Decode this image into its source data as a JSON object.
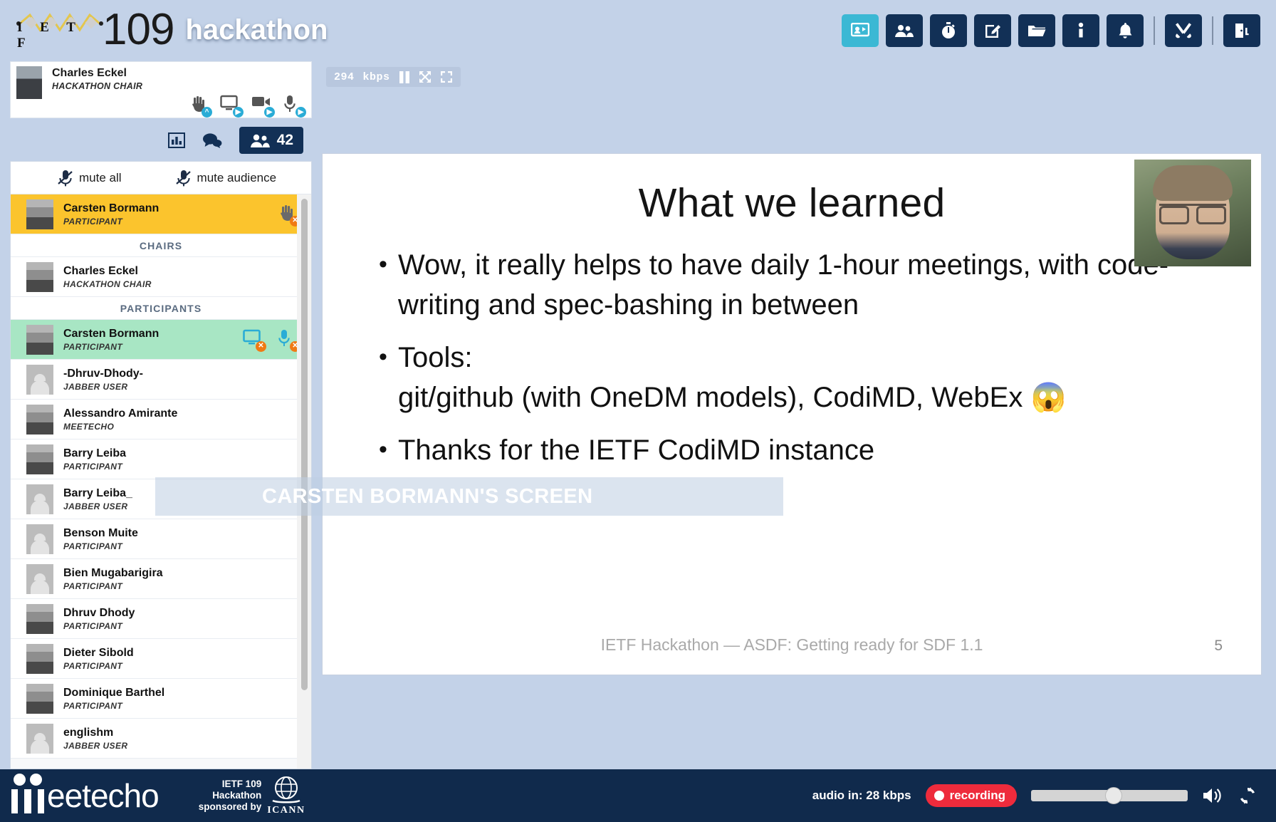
{
  "header": {
    "logo_letters": "I E T F",
    "number": "109",
    "event": "hackathon",
    "toolbar": [
      {
        "name": "share-screen-icon",
        "label": "Share screen",
        "active": true
      },
      {
        "name": "participants-icon",
        "label": "Participants",
        "active": false
      },
      {
        "name": "timer-icon",
        "label": "Timer",
        "active": false
      },
      {
        "name": "edit-icon",
        "label": "Notes",
        "active": false
      },
      {
        "name": "folder-icon",
        "label": "Materials",
        "active": false
      },
      {
        "name": "info-icon",
        "label": "Info",
        "active": false
      },
      {
        "name": "bell-icon",
        "label": "Notifications",
        "active": false
      },
      {
        "name": "tools-icon",
        "label": "Settings",
        "active": false
      },
      {
        "name": "exit-icon",
        "label": "Leave",
        "active": false
      }
    ]
  },
  "video_controls": {
    "bitrate": "294",
    "bitrate_unit": "kbps",
    "pause_icon": "pause-icon",
    "expand_icon": "expand-icon",
    "fullscreen_icon": "fullscreen-icon"
  },
  "presenter": {
    "name": "Charles Eckel",
    "role": "HACKATHON CHAIR",
    "actions": [
      "hand-icon",
      "screen-icon",
      "camera-icon",
      "microphone-icon"
    ]
  },
  "tabs": {
    "stats_icon": "stats-icon",
    "chat_icon": "chat-icon",
    "people_icon": "people-icon",
    "people_count": "42"
  },
  "mute_controls": {
    "mute_all": "mute all",
    "mute_audience": "mute audience",
    "icon": "mute-microphone-icon"
  },
  "participants": {
    "pinned": {
      "name": "Carsten Bormann",
      "role": "PARTICIPANT",
      "highlight": "#fbc42d",
      "actions": [
        "hand-icon"
      ]
    },
    "sections": [
      {
        "title": "CHAIRS",
        "rows": [
          {
            "name": "Charles Eckel",
            "role": "HACKATHON CHAIR",
            "avatar": "photo",
            "highlight": "",
            "actions": []
          }
        ]
      },
      {
        "title": "PARTICIPANTS",
        "rows": [
          {
            "name": "Carsten Bormann",
            "role": "PARTICIPANT",
            "avatar": "photo",
            "highlight": "#a8e6c4",
            "actions": [
              "screen-icon",
              "microphone-icon"
            ]
          },
          {
            "name": "-Dhruv-Dhody-",
            "role": "JABBER USER",
            "avatar": "generic",
            "highlight": "",
            "actions": []
          },
          {
            "name": "Alessandro Amirante",
            "role": "MEETECHO",
            "avatar": "photo",
            "highlight": "",
            "actions": []
          },
          {
            "name": "Barry Leiba",
            "role": "PARTICIPANT",
            "avatar": "photo",
            "highlight": "",
            "actions": []
          },
          {
            "name": "Barry Leiba_",
            "role": "JABBER USER",
            "avatar": "generic",
            "highlight": "",
            "actions": []
          },
          {
            "name": "Benson Muite",
            "role": "PARTICIPANT",
            "avatar": "generic",
            "highlight": "",
            "actions": []
          },
          {
            "name": "Bien Mugabarigira",
            "role": "PARTICIPANT",
            "avatar": "generic",
            "highlight": "",
            "actions": []
          },
          {
            "name": "Dhruv Dhody",
            "role": "PARTICIPANT",
            "avatar": "photo",
            "highlight": "",
            "actions": []
          },
          {
            "name": "Dieter Sibold",
            "role": "PARTICIPANT",
            "avatar": "photo",
            "highlight": "",
            "actions": []
          },
          {
            "name": "Dominique Barthel",
            "role": "PARTICIPANT",
            "avatar": "photo",
            "highlight": "",
            "actions": []
          },
          {
            "name": "englishm",
            "role": "JABBER USER",
            "avatar": "generic",
            "highlight": "",
            "actions": []
          }
        ]
      }
    ]
  },
  "slide": {
    "title": "What we learned",
    "bullets": [
      {
        "text": "Wow, it really helps to have daily 1-hour meetings, with code-writing and spec-bashing in between",
        "sub": ""
      },
      {
        "text": "Tools:",
        "sub": "git/github (with OneDM models), CodiMD, WebEx 😱"
      },
      {
        "text": "Thanks for the IETF CodiMD instance",
        "sub": ""
      }
    ],
    "footer": "IETF Hackathon — ASDF: Getting ready for SDF 1.1",
    "page_number": "5",
    "screen_banner": "CARSTEN BORMANN'S SCREEN"
  },
  "footer": {
    "product": "eetecho",
    "sponsor_line1": "IETF 109",
    "sponsor_line2": "Hackathon",
    "sponsor_line3": "sponsored by",
    "sponsor_org": "ICANN",
    "audio_in": "audio in: 28 kbps",
    "recording": "recording",
    "volume_icon": "speaker-icon",
    "refresh_icon": "refresh-icon"
  },
  "colors": {
    "header_bg": "#c3d2e8",
    "navy": "#102a4c",
    "accent_cyan": "#3bb8d4",
    "highlight_yellow": "#fbc42d",
    "highlight_green": "#a8e6c4",
    "recording_red": "#ee2b3c",
    "badge_orange": "#f07a14"
  }
}
